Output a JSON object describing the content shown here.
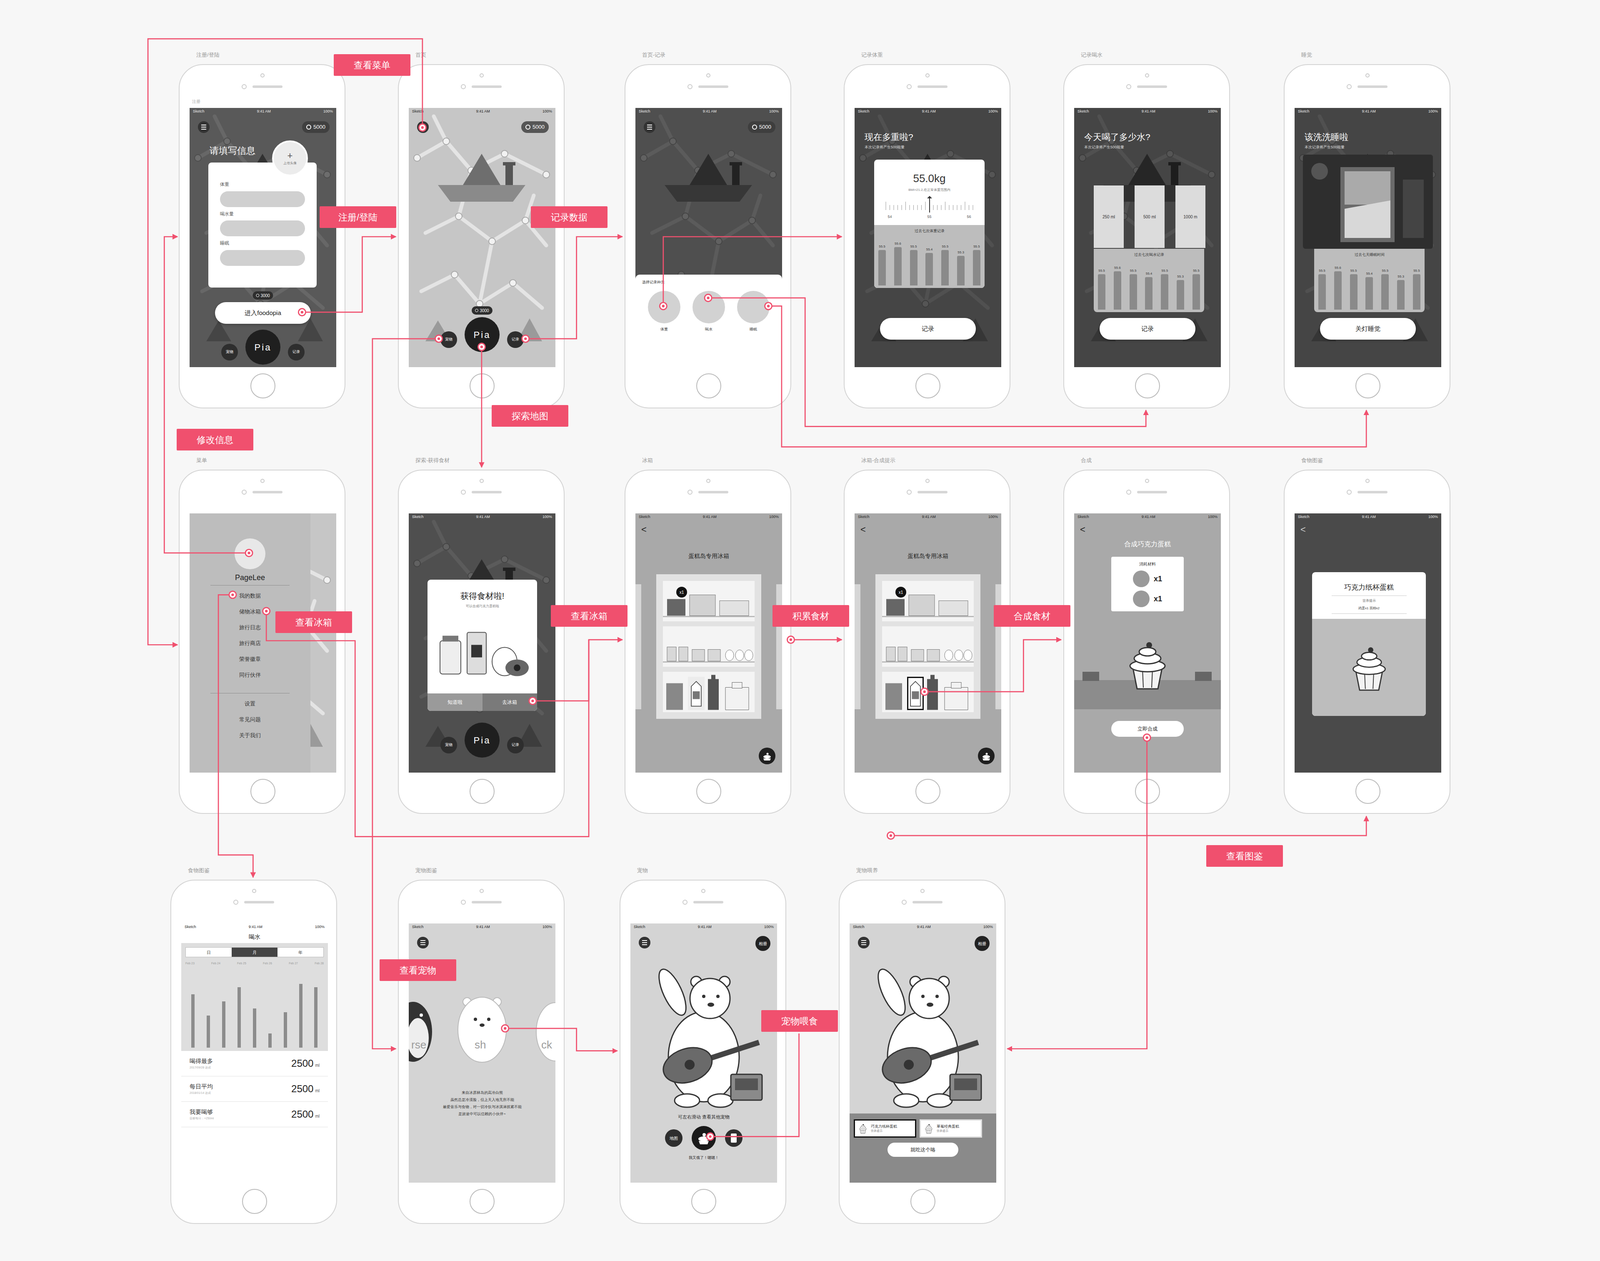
{
  "status_bar": {
    "carrier": "Sketch",
    "time": "9:41 AM",
    "battery": "100%"
  },
  "annotations": [
    {
      "text": "查看菜单"
    },
    {
      "text": "注册/登陆"
    },
    {
      "text": "记录数据"
    },
    {
      "text": "探索地图"
    },
    {
      "text": "修改信息"
    },
    {
      "text": "查看冰箱"
    },
    {
      "text": "查看冰箱"
    },
    {
      "text": "积累食材"
    },
    {
      "text": "合成食材"
    },
    {
      "text": "查看图鉴"
    },
    {
      "text": "查看宠物"
    },
    {
      "text": "宠物喂食"
    }
  ],
  "screens": [
    {
      "kind": "register",
      "label": "注册/登陆",
      "corner": "注册",
      "coins": "5000",
      "title": "请填写信息",
      "avatar": "+",
      "avatar_hint": "上传头像",
      "fields": [
        "体重",
        "喝水量",
        "睡眠"
      ],
      "badge": "3000",
      "button": "进入foodopia",
      "nav": [
        "宠物",
        "Pia",
        "记录"
      ]
    },
    {
      "kind": "home",
      "label": "首页",
      "coins": "5000",
      "badge": "3000",
      "nav": [
        "宠物",
        "Pia",
        "记录"
      ]
    },
    {
      "kind": "record",
      "label": "首页-记录",
      "coins": "5000",
      "sheet_title": "选择记录种类",
      "options": [
        "体重",
        "喝水",
        "睡眠"
      ]
    },
    {
      "kind": "weight",
      "label": "记录体重",
      "title": "现在多重啦?",
      "subtitle": "本次记录将产生500能量",
      "value": "55.0kg",
      "note": "BMI=21.2,在正常体重范围内",
      "ticks": [
        "54",
        "55",
        "56"
      ],
      "chart": {
        "title": "过去七次体重记录",
        "values": [
          55.5,
          55.6,
          55.5,
          55.4,
          55.5,
          55.3,
          55.5
        ],
        "labels": [
          "55.5",
          "55.6",
          "55.5",
          "55.4",
          "55.5",
          "55.3",
          "55.5"
        ]
      },
      "button": "记录"
    },
    {
      "kind": "water",
      "label": "记录喝水",
      "title": "今天喝了多少水?",
      "subtitle": "本次记录将产生500能量",
      "options": [
        "250 ml",
        "500 ml",
        "1000 m"
      ],
      "chart": {
        "title": "过去七次喝水记录",
        "values": [
          55.5,
          55.6,
          55.5,
          55.4,
          55.5,
          55.3,
          55.5
        ],
        "labels": [
          "55.5",
          "55.6",
          "55.5",
          "55.4",
          "55.5",
          "55.3",
          "55.5"
        ]
      },
      "button": "记录"
    },
    {
      "kind": "sleep",
      "label": "睡觉",
      "title": "该洗洗睡啦",
      "subtitle": "本次记录将产生500能量",
      "chart": {
        "title": "过去七天睡眠时间",
        "values": [
          55.5,
          55.6,
          55.5,
          55.4,
          55.5,
          55.3,
          55.5
        ],
        "labels": [
          "55.5",
          "55.6",
          "55.5",
          "55.4",
          "55.5",
          "55.3",
          "55.5"
        ]
      },
      "button": "关灯睡觉"
    },
    {
      "kind": "menu",
      "label": "菜单",
      "name": "PageLee",
      "items": [
        "我的数据",
        "储物冰箱",
        "旅行日志",
        "旅行商店",
        "荣誉徽章",
        "同行伙伴"
      ],
      "footer": [
        "设置",
        "常见问题",
        "关于我们"
      ]
    },
    {
      "kind": "explore",
      "label": "探索-获得食材",
      "title": "获得食材啦!",
      "subtitle": "可以合成巧克力蛋糕啦",
      "buttons": [
        "知道啦",
        "去冰箱"
      ],
      "nav": [
        "宠物",
        "Pia",
        "记录"
      ]
    },
    {
      "kind": "fridge",
      "label": "冰箱",
      "back": "<",
      "title": "蛋糕岛专用冰箱",
      "count": "x1",
      "highlight": false
    },
    {
      "kind": "fridge",
      "label": "冰箱-合成提示",
      "back": "<",
      "title": "蛋糕岛专用冰箱",
      "count": "x1",
      "highlight": true
    },
    {
      "kind": "compose",
      "label": "合成",
      "back": "<",
      "title": "合成巧克力蛋糕",
      "materials_title": "消耗材料",
      "materials": [
        "x1",
        "x1"
      ],
      "button": "立即合成"
    },
    {
      "kind": "dict",
      "label": "食物图鉴",
      "back": "<",
      "title": "巧克力纸杯蛋糕",
      "subtitle": "营养提示",
      "detail": "鸡蛋x1 面粉x2"
    },
    {
      "kind": "stats",
      "label": "食物图鉴",
      "title": "喝水",
      "tabs": [
        {
          "label": "日",
          "selected": false
        },
        {
          "label": "月",
          "selected": true
        },
        {
          "label": "年",
          "selected": false
        }
      ],
      "axis": [
        "Feb 23",
        "Feb 24",
        "Feb 25",
        "Feb 26",
        "Feb 27",
        "Feb 28"
      ],
      "values": [
        1500,
        900,
        1300,
        1700,
        1100,
        400,
        1000,
        1800,
        1700
      ],
      "rows": [
        {
          "label": "喝得最多",
          "date": "2017/09/28 达成",
          "value": "2500",
          "unit": "ml"
        },
        {
          "label": "每日平均",
          "date": "2018/01/14 达成",
          "value": "2500",
          "unit": "ml"
        },
        {
          "label": "我要喝够",
          "date": "目标每日：+250ml",
          "value": "2500",
          "unit": "ml"
        }
      ]
    },
    {
      "kind": "petdict",
      "label": "宠物图鉴",
      "names": [
        "rse",
        "sh",
        "ck"
      ],
      "description": [
        "来自冰原林岛的高冷白熊",
        "虽然总是冷漠脸，但上天入地无所不能",
        "最爱音乐与食物，对一切冷饮与冰淇淋抓紧不能",
        "是旅途中可以信赖的小伙伴~"
      ]
    },
    {
      "kind": "pet",
      "label": "宠物",
      "album": "相册",
      "hint": "可左右滑动 查看其他宠物",
      "map": "地图",
      "speech": "我又饿了！嗯嗯！"
    },
    {
      "kind": "feed",
      "label": "宠物喂养",
      "album": "相册",
      "foods": [
        {
          "name": "巧克力纸杯蛋糕",
          "note": "营养提示",
          "selected": true
        },
        {
          "name": "草莓经典蛋糕",
          "note": "营养提示",
          "selected": false
        }
      ],
      "button": "就吃这个咯"
    }
  ]
}
